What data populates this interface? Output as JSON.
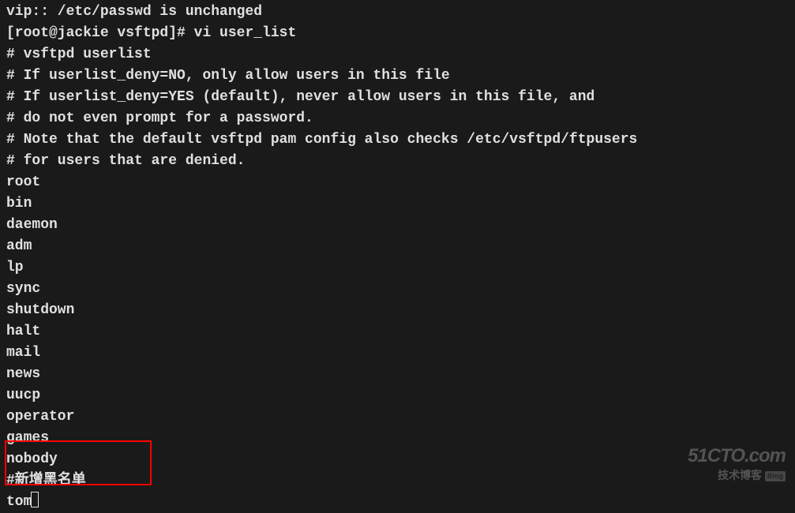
{
  "terminal": {
    "lines": [
      "vip:: /etc/passwd is unchanged",
      "[root@jackie vsftpd]# vi user_list",
      "",
      "# vsftpd userlist",
      "# If userlist_deny=NO, only allow users in this file",
      "# If userlist_deny=YES (default), never allow users in this file, and",
      "# do not even prompt for a password.",
      "# Note that the default vsftpd pam config also checks /etc/vsftpd/ftpusers",
      "# for users that are denied.",
      "root",
      "bin",
      "daemon",
      "adm",
      "lp",
      "sync",
      "shutdown",
      "halt",
      "mail",
      "news",
      "uucp",
      "operator",
      "games",
      "nobody",
      "#新增黑名单",
      "tom"
    ]
  },
  "watermark": {
    "main": "51CTO.com",
    "sub_cn": "技术博客",
    "badge": "Blog"
  }
}
